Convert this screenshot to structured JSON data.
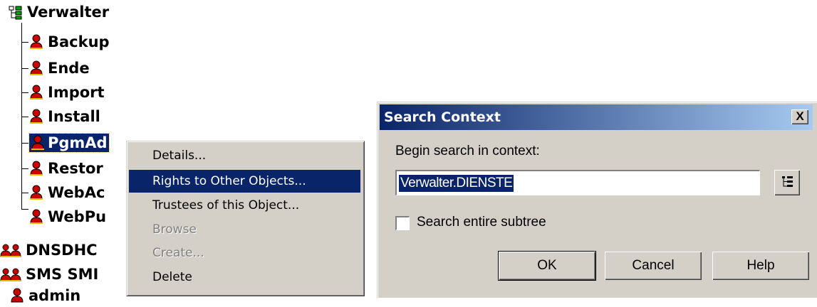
{
  "tree": {
    "root": {
      "label": "Verwalter",
      "icon": "tree-container-icon"
    },
    "children": [
      {
        "label": "Backup",
        "icon": "user-icon"
      },
      {
        "label": "Ende",
        "icon": "user-icon"
      },
      {
        "label": "Import",
        "icon": "user-icon"
      },
      {
        "label": "Install",
        "icon": "user-icon"
      },
      {
        "label": "PgmAd",
        "icon": "user-icon",
        "selected": true
      },
      {
        "label": "Restor",
        "icon": "user-icon"
      },
      {
        "label": "WebAc",
        "icon": "user-icon"
      },
      {
        "label": "WebPu",
        "icon": "user-icon"
      }
    ],
    "groups": [
      {
        "label": "DNSDHC",
        "icon": "group-icon"
      },
      {
        "label": "SMS SMI",
        "icon": "group-icon"
      },
      {
        "label": "admin",
        "icon": "user-icon"
      }
    ]
  },
  "context_menu": {
    "items": [
      {
        "label": "Details...",
        "state": "normal"
      },
      {
        "label": "Rights to Other Objects...",
        "state": "highlighted"
      },
      {
        "label": "Trustees of this Object...",
        "state": "normal"
      },
      {
        "label": "Browse",
        "state": "disabled"
      },
      {
        "label": "Create...",
        "state": "disabled"
      },
      {
        "label": "Delete",
        "state": "normal"
      }
    ]
  },
  "dialog": {
    "title": "Search Context",
    "close_label": "X",
    "begin_label": "Begin search in context:",
    "context_value": "Verwalter.DIENSTE",
    "subtree_label": "Search entire subtree",
    "subtree_checked": false,
    "ok_label": "OK",
    "cancel_label": "Cancel",
    "help_label": "Help"
  },
  "colors": {
    "face": "#d4d0c8",
    "selection": "#0a246a",
    "title_gradient_end": "#a6caf0",
    "user_icon_red": "#cc0000"
  }
}
